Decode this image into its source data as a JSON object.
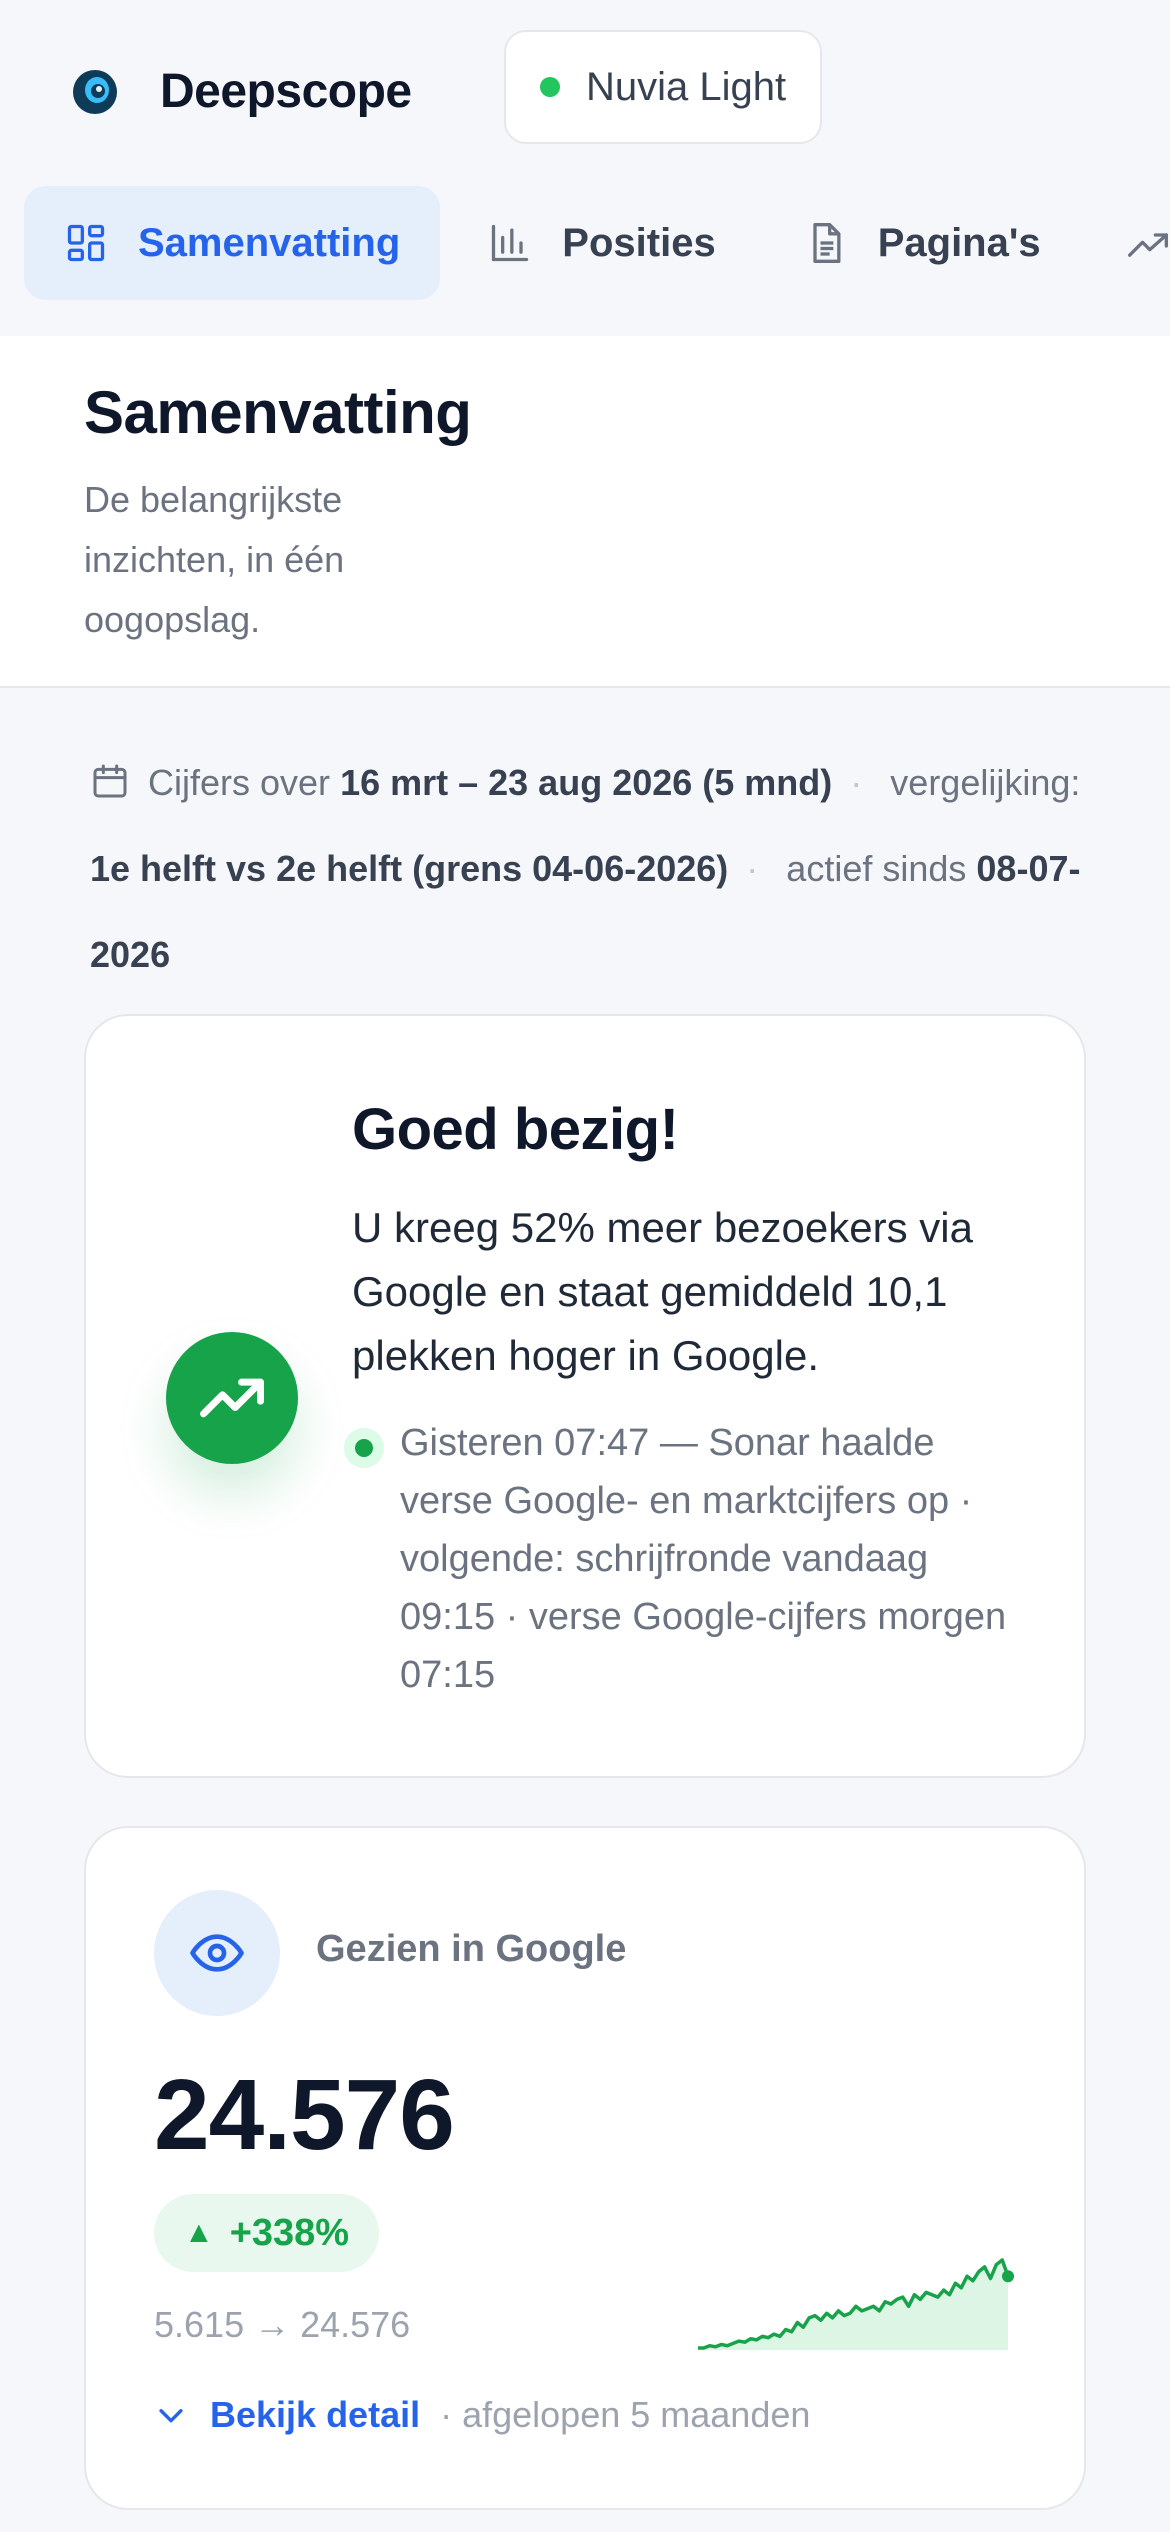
{
  "app": {
    "name": "Deepscope"
  },
  "site": {
    "name": "Nuvia Light",
    "status_color": "#22c55e"
  },
  "tabs": [
    {
      "label": "Samenvatting",
      "icon": "dashboard-grid-icon",
      "active": true
    },
    {
      "label": "Posities",
      "icon": "bar-chart-icon",
      "active": false
    },
    {
      "label": "Pagina's",
      "icon": "document-icon",
      "active": false
    },
    {
      "label": "",
      "icon": "trend-up-icon",
      "active": false
    }
  ],
  "page": {
    "title": "Samenvatting",
    "subtitle": "De belangrijkste inzichten, in één oogopslag."
  },
  "meta": {
    "period_prefix": "Cijfers over",
    "period_value": "16 mrt – 23 aug 2026 (5 mnd)",
    "compare_prefix": "vergelijking:",
    "compare_value": "1e helft vs 2e helft (grens 04-06-2026)",
    "active_prefix": "actief sinds",
    "active_value": "08-07-2026",
    "separator": "·"
  },
  "hero": {
    "title": "Goed bezig!",
    "text": "U kreeg 52% meer bezoekers via Google en staat gemiddeld 10,1 plekken hoger in Google.",
    "status": "Gisteren 07:47 — Sonar haalde verse Google- en marktcijfers op · volgende: schrijfronde vandaag 09:15 · verse Google-cijfers morgen 07:15",
    "accent": "#16a34a"
  },
  "metric": {
    "label": "Gezien in Google",
    "value": "24.576",
    "delta_arrow": "▲",
    "delta": "+338%",
    "range": "5.615 → 24.576",
    "detail_link": "Bekijk detail",
    "period": "· afgelopen 5 maanden",
    "accent": "#2563eb",
    "positive_color": "#16a34a"
  },
  "chart_data": {
    "type": "area",
    "title": "",
    "series": [
      {
        "name": "",
        "values": [
          2,
          2,
          3,
          2.5,
          3.5,
          3,
          4,
          5,
          4.5,
          6,
          5.5,
          7,
          6.5,
          8,
          7,
          10,
          9,
          13,
          11,
          15,
          16,
          14,
          17,
          15,
          18,
          16,
          17,
          20,
          18,
          19,
          20,
          18,
          22,
          21,
          23,
          24,
          20,
          25,
          23,
          26,
          25,
          24,
          27,
          25,
          30,
          28,
          33,
          31,
          35,
          37,
          32,
          38,
          40,
          33
        ]
      }
    ]
  }
}
